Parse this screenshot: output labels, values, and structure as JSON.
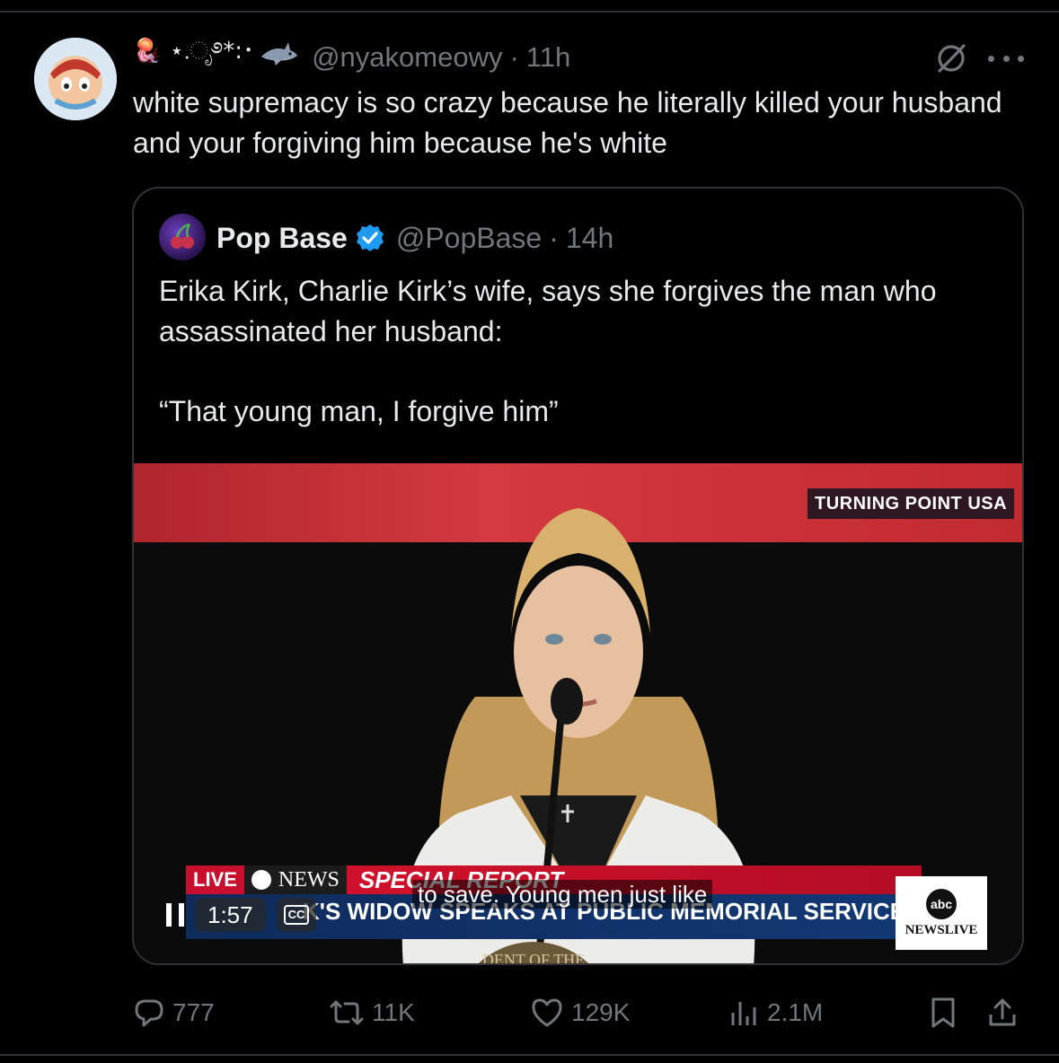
{
  "tweet": {
    "display_name": "🪼 ⋆.ೃ࿔*:･",
    "handle": "@nyakomeowy",
    "separator": "·",
    "time": "11h",
    "text": "white supremacy is so crazy because he literally killed your husband and your forgiving him because he's white"
  },
  "quote": {
    "name": "Pop Base",
    "handle": "@PopBase",
    "separator": "·",
    "time": "14h",
    "text": "Erika Kirk, Charlie Kirk’s wife, says she forgives the man who assassinated her husband:",
    "quote_line": "“That young man, I forgive him”",
    "media": {
      "stage_tag": "TURNING POINT USA",
      "live_tag": "LIVE",
      "news_tag": "NEWS",
      "special_report": "SPECIAL REPORT",
      "headline": "K'S WIDOW SPEAKS AT PUBLIC MEMORIAL SERVICE",
      "caption": "to save. Young men just like",
      "badge_logo": "abc",
      "badge_text": "NEWSLIVE",
      "timestamp": "1:57",
      "cc_label": "CC",
      "seal_text": "DENT OF THE"
    }
  },
  "actions": {
    "replies": "777",
    "reposts": "11K",
    "likes": "129K",
    "views": "2.1M"
  },
  "colors": {
    "background": "#000000",
    "text": "#e7e9ea",
    "muted": "#71767b",
    "border": "#2f3336",
    "verified": "#1d9bf0",
    "stage_red": "#c22a31",
    "news_blue": "#0f2b5c"
  }
}
